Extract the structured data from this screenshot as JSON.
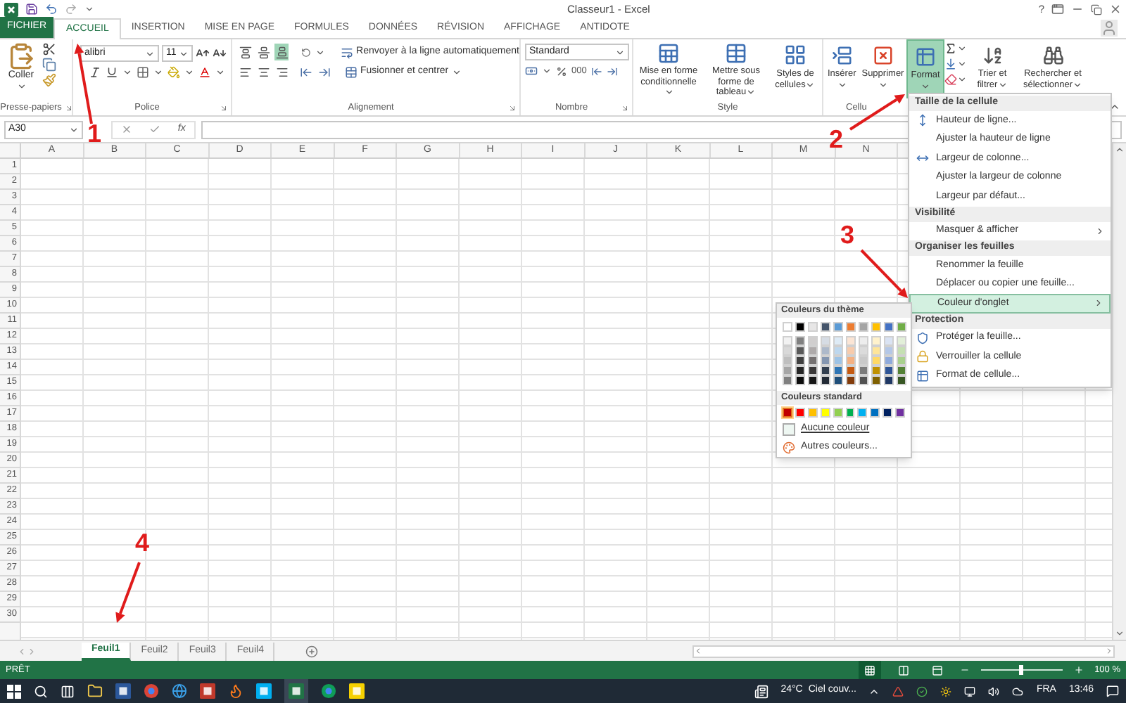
{
  "window": {
    "title": "Classeur1 - Excel",
    "help": "?"
  },
  "tabs": [
    {
      "label": "FICHIER",
      "kind": "file",
      "selected": false
    },
    {
      "label": "ACCUEIL",
      "kind": "tab",
      "selected": true
    },
    {
      "label": "INSERTION",
      "kind": "tab",
      "selected": false
    },
    {
      "label": "MISE EN PAGE",
      "kind": "tab",
      "selected": false
    },
    {
      "label": "FORMULES",
      "kind": "tab",
      "selected": false
    },
    {
      "label": "DONNÉES",
      "kind": "tab",
      "selected": false
    },
    {
      "label": "RÉVISION",
      "kind": "tab",
      "selected": false
    },
    {
      "label": "AFFICHAGE",
      "kind": "tab",
      "selected": false
    },
    {
      "label": "ANTIDOTE",
      "kind": "tab",
      "selected": false
    }
  ],
  "ribbon": {
    "clipboard": {
      "paste": "Coller",
      "label": "Presse-papiers"
    },
    "font": {
      "name": "alibri",
      "size": "11",
      "label": "Police"
    },
    "alignment": {
      "vertical": [
        {
          "selected": false
        },
        {
          "selected": false
        },
        {
          "selected": true
        }
      ],
      "wrap": "Renvoyer à la ligne automatiquement",
      "merge": "Fusionner et centrer",
      "label": "Alignement"
    },
    "number": {
      "format": "Standard",
      "thousands": "000",
      "label": "Nombre"
    },
    "style": {
      "buttons": [
        "Mise en forme conditionnelle",
        "Mettre sous forme de tableau",
        "Styles de cellules"
      ],
      "label": "Style"
    },
    "cells": {
      "buttons": [
        {
          "label": "Insérer",
          "selected": false
        },
        {
          "label": "Supprimer",
          "selected": false
        },
        {
          "label": "Format",
          "selected": true
        }
      ],
      "label": "Cellu"
    },
    "editing": {
      "buttons": [
        "Trier et filtrer",
        "Rechercher et sélectionner"
      ]
    }
  },
  "formula_bar": {
    "name_box": "A30",
    "fx": "fx"
  },
  "sheet": {
    "columns": [
      "A",
      "B",
      "C",
      "D",
      "E",
      "F",
      "G",
      "H",
      "I",
      "J",
      "K",
      "L",
      "M",
      "N"
    ],
    "rows": [
      "1",
      "2",
      "3",
      "4",
      "5",
      "6",
      "7",
      "8",
      "9",
      "10",
      "11",
      "12",
      "13",
      "14",
      "15",
      "16",
      "17",
      "18",
      "19",
      "20",
      "21",
      "22",
      "23",
      "24",
      "25",
      "26",
      "27",
      "28",
      "29",
      "30"
    ]
  },
  "format_menu": {
    "sections": [
      {
        "header": "Taille de la cellule",
        "items": [
          {
            "label": "Hauteur de ligne...",
            "kind": "row-height",
            "selected": false
          },
          {
            "label": "Ajuster la hauteur de ligne",
            "kind": "plain",
            "selected": false
          },
          {
            "label": "Largeur de colonne...",
            "kind": "column-width",
            "selected": false
          },
          {
            "label": "Ajuster la largeur de colonne",
            "kind": "plain",
            "selected": false
          },
          {
            "label": "Largeur par défaut...",
            "kind": "plain",
            "selected": false
          }
        ]
      },
      {
        "header": "Visibilité",
        "items": [
          {
            "label": "Masquer & afficher",
            "kind": "submenu",
            "selected": false
          }
        ]
      },
      {
        "header": "Organiser les feuilles",
        "items": [
          {
            "label": "Renommer la feuille",
            "kind": "plain",
            "selected": false
          },
          {
            "label": "Déplacer ou copier une feuille...",
            "kind": "plain",
            "selected": false
          },
          {
            "label": "Couleur d'onglet",
            "kind": "submenu",
            "selected": true
          }
        ]
      },
      {
        "header": "Protection",
        "items": [
          {
            "label": "Protéger la feuille...",
            "kind": "protect",
            "selected": false
          },
          {
            "label": "Verrouiller la cellule",
            "kind": "lock",
            "selected": false
          },
          {
            "label": "Format de cellule...",
            "kind": "format-cells",
            "selected": false
          }
        ]
      }
    ]
  },
  "tab_color_menu": {
    "theme_header": "Couleurs du thème",
    "theme": [
      {
        "shades": [
          {
            "color": "#ffffff"
          },
          {
            "color": "#f2f2f2"
          },
          {
            "color": "#d9d9d9"
          },
          {
            "color": "#bfbfbf"
          },
          {
            "color": "#a6a6a6"
          },
          {
            "color": "#808080"
          }
        ]
      },
      {
        "shades": [
          {
            "color": "#000000"
          },
          {
            "color": "#808080"
          },
          {
            "color": "#595959"
          },
          {
            "color": "#404040"
          },
          {
            "color": "#262626"
          },
          {
            "color": "#0d0d0d"
          }
        ]
      },
      {
        "shades": [
          {
            "color": "#e7e6e6"
          },
          {
            "color": "#d0cece"
          },
          {
            "color": "#aeaaaa"
          },
          {
            "color": "#757171"
          },
          {
            "color": "#3a3838"
          },
          {
            "color": "#161616"
          }
        ]
      },
      {
        "shades": [
          {
            "color": "#44546a"
          },
          {
            "color": "#d6dce4"
          },
          {
            "color": "#adb9ca"
          },
          {
            "color": "#8496b0"
          },
          {
            "color": "#323f4f"
          },
          {
            "color": "#222a35"
          }
        ]
      },
      {
        "shades": [
          {
            "color": "#5b9bd5"
          },
          {
            "color": "#deebf6"
          },
          {
            "color": "#bdd7ee"
          },
          {
            "color": "#9dc3e6"
          },
          {
            "color": "#2e75b5"
          },
          {
            "color": "#1f4e79"
          }
        ]
      },
      {
        "shades": [
          {
            "color": "#ed7d31"
          },
          {
            "color": "#fbe5d5"
          },
          {
            "color": "#f7cbac"
          },
          {
            "color": "#f4b183"
          },
          {
            "color": "#c55a11"
          },
          {
            "color": "#833c0b"
          }
        ]
      },
      {
        "shades": [
          {
            "color": "#a5a5a5"
          },
          {
            "color": "#ededed"
          },
          {
            "color": "#dbdbdb"
          },
          {
            "color": "#c9c9c9"
          },
          {
            "color": "#7b7b7b"
          },
          {
            "color": "#525252"
          }
        ]
      },
      {
        "shades": [
          {
            "color": "#ffc000"
          },
          {
            "color": "#fff2cc"
          },
          {
            "color": "#fee599"
          },
          {
            "color": "#ffd965"
          },
          {
            "color": "#bf9000"
          },
          {
            "color": "#7f6000"
          }
        ]
      },
      {
        "shades": [
          {
            "color": "#4472c4"
          },
          {
            "color": "#dae3f3"
          },
          {
            "color": "#b4c7e7"
          },
          {
            "color": "#8faadc"
          },
          {
            "color": "#2f5597"
          },
          {
            "color": "#203864"
          }
        ]
      },
      {
        "shades": [
          {
            "color": "#70ad47"
          },
          {
            "color": "#e2efd9"
          },
          {
            "color": "#c5e0b3"
          },
          {
            "color": "#a8d08d"
          },
          {
            "color": "#538135"
          },
          {
            "color": "#375623"
          }
        ]
      }
    ],
    "standard_header": "Couleurs standard",
    "standard": [
      {
        "color": "#c00000",
        "selected": true
      },
      {
        "color": "#ff0000",
        "selected": false
      },
      {
        "color": "#ffc000",
        "selected": false
      },
      {
        "color": "#ffff00",
        "selected": false
      },
      {
        "color": "#92d050",
        "selected": false
      },
      {
        "color": "#00b050",
        "selected": false
      },
      {
        "color": "#00b0f0",
        "selected": false
      },
      {
        "color": "#0070c0",
        "selected": false
      },
      {
        "color": "#002060",
        "selected": false
      },
      {
        "color": "#7030a0",
        "selected": false
      }
    ],
    "no_color": "Aucune couleur",
    "more_colors": "Autres couleurs..."
  },
  "sheet_tabs": [
    {
      "label": "Feuil1",
      "selected": true
    },
    {
      "label": "Feuil2",
      "selected": false
    },
    {
      "label": "Feuil3",
      "selected": false
    },
    {
      "label": "Feuil4",
      "selected": false
    }
  ],
  "status_bar": {
    "status": "PRÊT",
    "views": [
      {
        "selected": true
      },
      {
        "selected": false
      },
      {
        "selected": false
      }
    ],
    "zoom": {
      "level": 0.5,
      "reading": "100 %"
    }
  },
  "taskbar": {
    "temperature": "24°C",
    "weather": "Ciel couv...",
    "language": "FRA",
    "time": "13:46"
  },
  "annotations": [
    {
      "number": "1"
    },
    {
      "number": "2"
    },
    {
      "number": "3"
    },
    {
      "number": "4"
    }
  ]
}
